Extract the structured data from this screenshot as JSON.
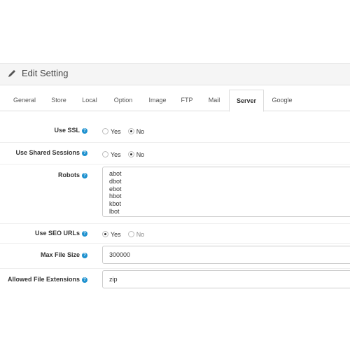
{
  "panel": {
    "title": "Edit Setting",
    "icon": "pencil-icon"
  },
  "tabs": [
    {
      "label": "General"
    },
    {
      "label": "Store"
    },
    {
      "label": "Local"
    },
    {
      "label": "Option"
    },
    {
      "label": "Image"
    },
    {
      "label": "FTP"
    },
    {
      "label": "Mail"
    },
    {
      "label": "Server",
      "active": true
    },
    {
      "label": "Google"
    }
  ],
  "fields": {
    "use_ssl": {
      "label": "Use SSL",
      "yes": "Yes",
      "no": "No",
      "selected": "No"
    },
    "use_shared_sessions": {
      "label": "Use Shared Sessions",
      "yes": "Yes",
      "no": "No",
      "selected": "No"
    },
    "robots": {
      "label": "Robots",
      "lines": [
        "abot",
        "dbot",
        "ebot",
        "hbot",
        "kbot",
        "lbot"
      ]
    },
    "use_seo_urls": {
      "label": "Use SEO URLs",
      "yes": "Yes",
      "no": "No",
      "selected": "Yes"
    },
    "max_file_size": {
      "label": "Max File Size",
      "value": "300000"
    },
    "allowed_file_extensions": {
      "label": "Allowed File Extensions",
      "value": "zip"
    }
  },
  "help_glyph": "?",
  "colors": {
    "help": "#1e91cf",
    "panel_bg": "#f5f5f5"
  }
}
